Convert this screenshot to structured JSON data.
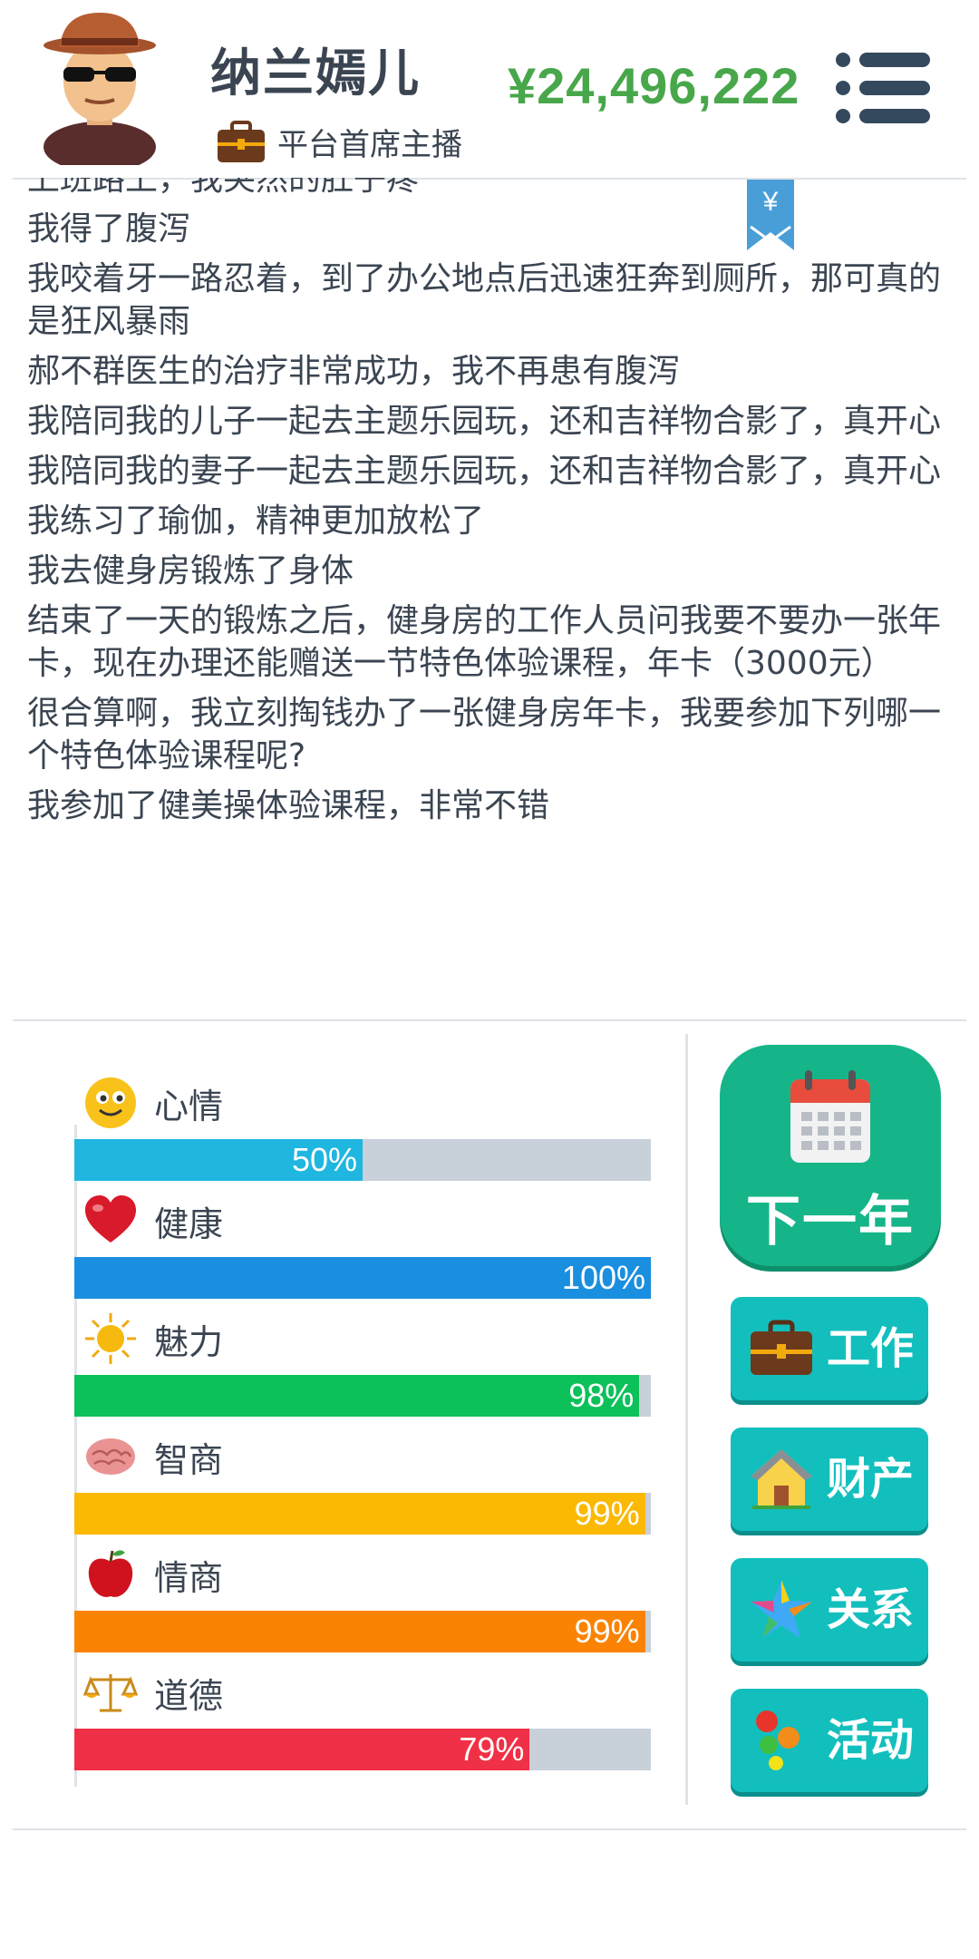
{
  "header": {
    "name": "纳兰嫣儿",
    "job": "平台首席主播",
    "money": "¥24,496,222"
  },
  "log": [
    "上班路上，我突然的肚子疼",
    "我得了腹泻",
    "我咬着牙一路忍着，到了办公地点后迅速狂奔到厕所，那可真的是狂风暴雨",
    "郝不群医生的治疗非常成功，我不再患有腹泻",
    "我陪同我的儿子一起去主题乐园玩，还和吉祥物合影了，真开心",
    "我陪同我的妻子一起去主题乐园玩，还和吉祥物合影了，真开心",
    "我练习了瑜伽，精神更加放松了",
    "我去健身房锻炼了身体",
    "结束了一天的锻炼之后，健身房的工作人员问我要不要办一张年卡，现在办理还能赠送一节特色体验课程，年卡（3000元）",
    "很合算啊，我立刻掏钱办了一张健身房年卡，我要参加下列哪一个特色体验课程呢?",
    "我参加了健美操体验课程，非常不错"
  ],
  "ribbon_symbol": "¥",
  "stats": [
    {
      "label": "心情",
      "value": 50,
      "pct": "50%",
      "icon": "smiley-icon",
      "color": "#1fb6e0"
    },
    {
      "label": "健康",
      "value": 100,
      "pct": "100%",
      "icon": "heart-icon",
      "color": "#1a8fe0"
    },
    {
      "label": "魅力",
      "value": 98,
      "pct": "98%",
      "icon": "sun-icon",
      "color": "#0cc15a"
    },
    {
      "label": "智商",
      "value": 99,
      "pct": "99%",
      "icon": "brain-icon",
      "color": "#fbb904"
    },
    {
      "label": "情商",
      "value": 99,
      "pct": "99%",
      "icon": "apple-icon",
      "color": "#fb8304"
    },
    {
      "label": "道德",
      "value": 79,
      "pct": "79%",
      "icon": "scales-icon",
      "color": "#f03046"
    }
  ],
  "buttons": {
    "next_year": "下一年",
    "work": "工作",
    "property": "财产",
    "relations": "关系",
    "activities": "活动"
  }
}
